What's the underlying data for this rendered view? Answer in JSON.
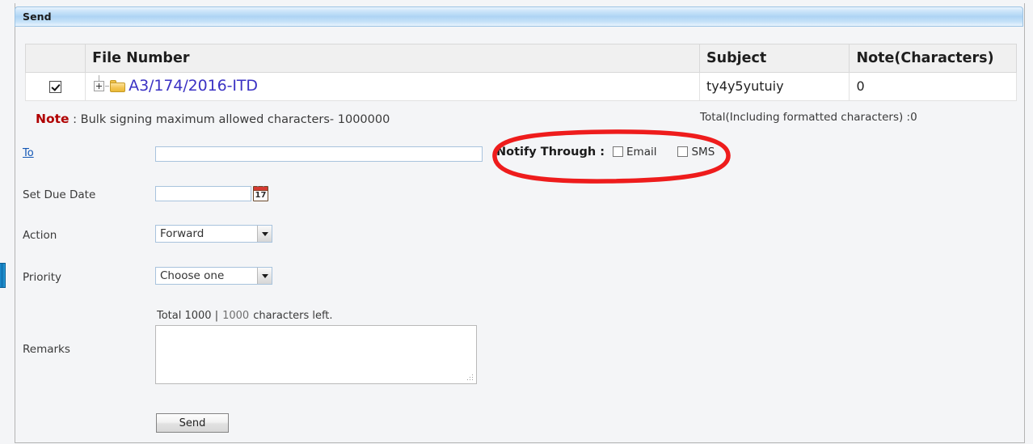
{
  "window": {
    "title": "Send"
  },
  "collapse_handle": {
    "name": "panel-collapse-handle"
  },
  "file_table": {
    "columns": [
      "",
      "File Number",
      "Subject",
      "Note(Characters)"
    ],
    "rows": [
      {
        "checked": true,
        "file_number": "A3/174/2016-ITD",
        "subject": "ty4y5yutuiy",
        "note_characters": "0"
      }
    ]
  },
  "note": {
    "label": "Note",
    "separator": " : ",
    "text": "Bulk signing maximum allowed characters-  1000000"
  },
  "total_characters": {
    "text": "Total(Including formatted characters) :0"
  },
  "form": {
    "to": {
      "label": "To",
      "value": "",
      "placeholder": ""
    },
    "due_date": {
      "label": "Set Due Date",
      "value": "",
      "placeholder": "",
      "calendar_icon_day": "17"
    },
    "action": {
      "label": "Action",
      "selected": "Forward"
    },
    "priority": {
      "label": "Priority",
      "selected": "Choose one"
    },
    "remarks": {
      "label": "Remarks",
      "total_text": "Total 1000 |",
      "left_count": "1000",
      "left_suffix": "characters left.",
      "value": ""
    },
    "send_button": {
      "label": "Send"
    }
  },
  "notify_through": {
    "label": "Notify Through :",
    "options": [
      {
        "label": "Email",
        "checked": false
      },
      {
        "label": "SMS",
        "checked": false
      }
    ],
    "highlight_color": "#ee1c1c"
  },
  "colors": {
    "titlebar_blue": "#aed4f4",
    "link_blue": "#1357b5",
    "file_link": "#3b32c4",
    "note_red": "#b00000",
    "folder_gold": "#f3c453",
    "handle_blue": "#1e8fd0"
  }
}
